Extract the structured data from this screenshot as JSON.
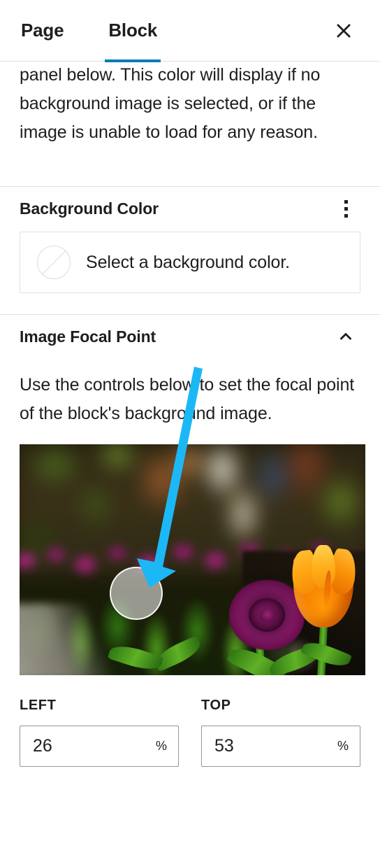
{
  "header": {
    "tabs": [
      {
        "label": "Page",
        "active": false
      },
      {
        "label": "Block",
        "active": true
      }
    ],
    "close_label": "Close settings",
    "active_tab_color": "#007cba"
  },
  "intro": {
    "text": "panel below. This color will display if no background image is selected, or if the image is unable to load for any reason."
  },
  "background_color": {
    "title": "Background Color",
    "options_label": "Options",
    "select_button_label": "Select a background color.",
    "swatch_state": "none"
  },
  "image_focal_point": {
    "title": "Image Focal Point",
    "collapse_label": "Collapse",
    "description": "Use the controls below to set the focal point of the block's background image.",
    "preview_alt": "Garden of purple and orange tulips in bloom",
    "focal_dot_label": "Focal point picker handle",
    "controls": [
      {
        "label": "LEFT",
        "value": "26",
        "unit": "%",
        "placeholder": "0"
      },
      {
        "label": "TOP",
        "value": "53",
        "unit": "%",
        "placeholder": "0"
      }
    ]
  },
  "annotation": {
    "arrow_color": "#1cb8f5",
    "arrow_target": "Image focal point preview"
  }
}
